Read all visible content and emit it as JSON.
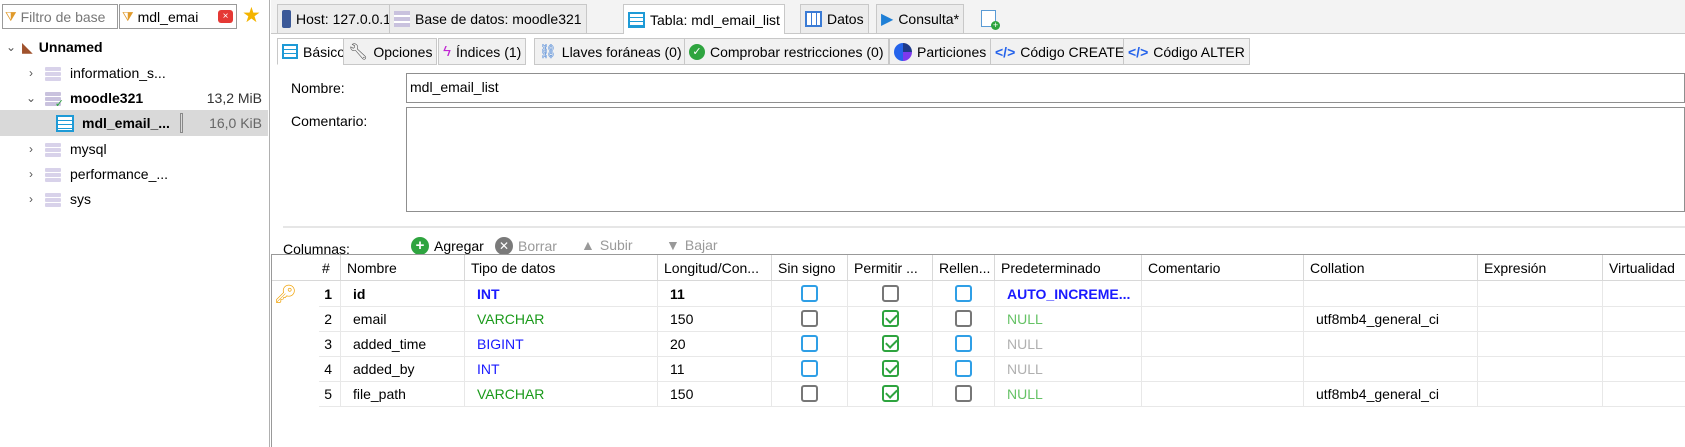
{
  "filters": {
    "db_filter_placeholder": "Filtro de base",
    "table_filter_value": "mdl_emai"
  },
  "tree": {
    "root": "Unnamed",
    "items": [
      {
        "label": "information_s...",
        "size": ""
      },
      {
        "label": "moodle321",
        "size": "13,2 MiB"
      },
      {
        "label": "mdl_email_...",
        "size": "16,0 KiB"
      },
      {
        "label": "mysql",
        "size": ""
      },
      {
        "label": "performance_...",
        "size": ""
      },
      {
        "label": "sys",
        "size": ""
      }
    ]
  },
  "top_tabs": [
    {
      "label": "Host: 127.0.0.1"
    },
    {
      "label": "Base de datos: moodle321"
    },
    {
      "label": "Tabla: mdl_email_list"
    },
    {
      "label": "Datos"
    },
    {
      "label": "Consulta*"
    }
  ],
  "sub_tabs": [
    {
      "label": "Básico"
    },
    {
      "label": "Opciones"
    },
    {
      "label": "Índices (1)"
    },
    {
      "label": "Llaves foráneas (0)"
    },
    {
      "label": "Comprobar restricciones (0)"
    },
    {
      "label": "Particiones"
    },
    {
      "label": "Código CREATE"
    },
    {
      "label": "Código ALTER"
    }
  ],
  "form": {
    "name_label": "Nombre:",
    "name_value": "mdl_email_list",
    "comment_label": "Comentario:",
    "comment_value": ""
  },
  "toolbar": {
    "columns_label": "Columnas:",
    "add": "Agregar",
    "delete": "Borrar",
    "up": "Subir",
    "down": "Bajar"
  },
  "grid": {
    "headers": [
      "#",
      "Nombre",
      "Tipo de datos",
      "Longitud/Con...",
      "Sin signo",
      "Permitir ...",
      "Rellen...",
      "Predeterminado",
      "Comentario",
      "Collation",
      "Expresión",
      "Virtualidad"
    ],
    "rows": [
      {
        "n": "1",
        "name": "id",
        "type": "INT",
        "length": "11",
        "unsigned": false,
        "allow_null": false,
        "zerofill": false,
        "default": "AUTO_INCREME...",
        "comment": "",
        "collation": "",
        "expression": "",
        "virtuality": ""
      },
      {
        "n": "2",
        "name": "email",
        "type": "VARCHAR",
        "length": "150",
        "unsigned": false,
        "allow_null": true,
        "zerofill": false,
        "default": "NULL",
        "comment": "",
        "collation": "utf8mb4_general_ci",
        "expression": "",
        "virtuality": ""
      },
      {
        "n": "3",
        "name": "added_time",
        "type": "BIGINT",
        "length": "20",
        "unsigned": false,
        "allow_null": true,
        "zerofill": false,
        "default": "NULL",
        "comment": "",
        "collation": "",
        "expression": "",
        "virtuality": ""
      },
      {
        "n": "4",
        "name": "added_by",
        "type": "INT",
        "length": "11",
        "unsigned": false,
        "allow_null": true,
        "zerofill": false,
        "default": "NULL",
        "comment": "",
        "collation": "",
        "expression": "",
        "virtuality": ""
      },
      {
        "n": "5",
        "name": "file_path",
        "type": "VARCHAR",
        "length": "150",
        "unsigned": false,
        "allow_null": true,
        "zerofill": false,
        "default": "NULL",
        "comment": "",
        "collation": "utf8mb4_general_ci",
        "expression": "",
        "virtuality": ""
      }
    ]
  },
  "colors": {
    "int_blue": "#1a1aff",
    "varchar_green": "#1a9a1a",
    "null_green": "#66c266",
    "null_gray": "#b0b0b0",
    "selection": "#d9d9d9"
  }
}
